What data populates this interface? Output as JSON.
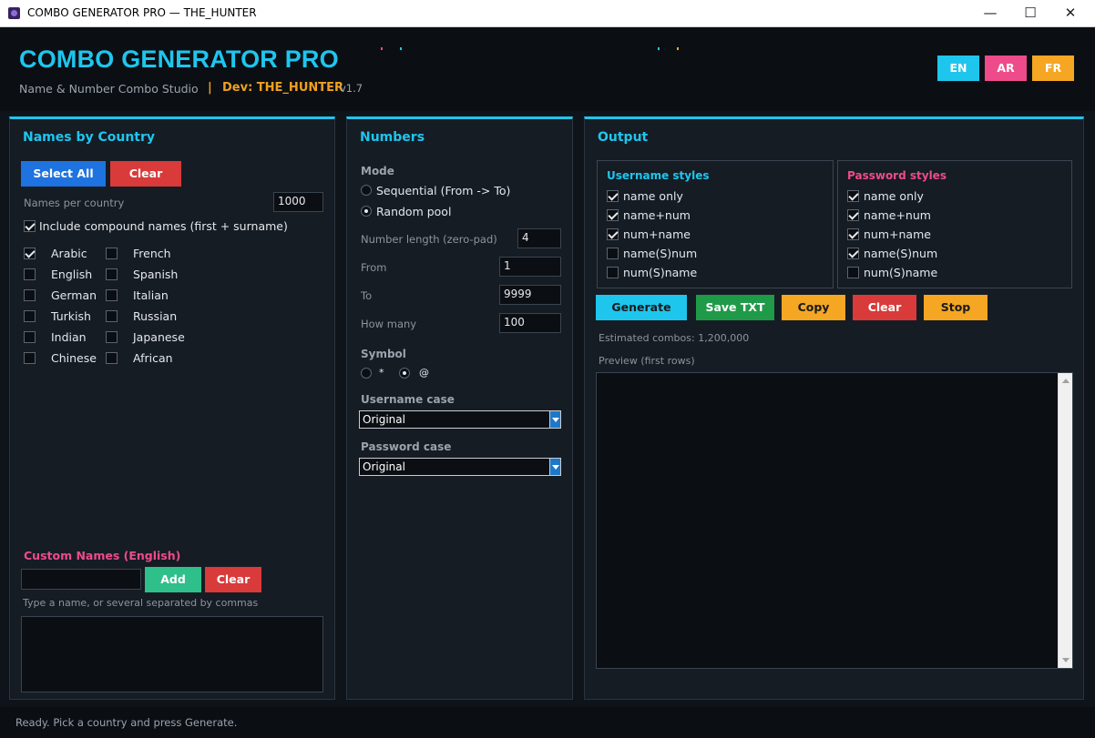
{
  "window": {
    "title": "COMBO GENERATOR PRO — THE_HUNTER",
    "minimize": "—",
    "maximize": "☐",
    "close": "✕"
  },
  "header": {
    "app_name": "COMBO GENERATOR PRO",
    "subtitle": "Name & Number Combo Studio",
    "separator": "|",
    "dev": "Dev: THE_HUNTER",
    "version": "v1.7",
    "languages": [
      "EN",
      "AR",
      "FR"
    ],
    "colors": {
      "accent": "#1ec6ee",
      "dev": "#f0a020",
      "ar": "#ee4b8a",
      "fr": "#f5a623"
    }
  },
  "names_panel": {
    "title": "Names by Country",
    "select_all": "Select All",
    "clear": "Clear",
    "per_country_label": "Names per country",
    "per_country_value": "1000",
    "compound_label": "Include compound names (first + surname)",
    "compound_checked": true,
    "countries": [
      {
        "label": "Arabic",
        "checked": true
      },
      {
        "label": "French",
        "checked": false
      },
      {
        "label": "English",
        "checked": false
      },
      {
        "label": "Spanish",
        "checked": false
      },
      {
        "label": "German",
        "checked": false
      },
      {
        "label": "Italian",
        "checked": false
      },
      {
        "label": "Turkish",
        "checked": false
      },
      {
        "label": "Russian",
        "checked": false
      },
      {
        "label": "Indian",
        "checked": false
      },
      {
        "label": "Japanese",
        "checked": false
      },
      {
        "label": "Chinese",
        "checked": false
      },
      {
        "label": "African",
        "checked": false
      }
    ],
    "custom_title": "Custom Names (English)",
    "custom_input_value": "",
    "add": "Add",
    "custom_clear": "Clear",
    "custom_hint": "Type a name, or several separated by commas"
  },
  "numbers_panel": {
    "title": "Numbers",
    "mode_label": "Mode",
    "mode_options": [
      "Sequential (From -> To)",
      "Random pool"
    ],
    "mode_selected": "Random pool",
    "length_label": "Number length (zero-pad)",
    "length_value": "4",
    "from_label": "From",
    "from_value": "1",
    "to_label": "To",
    "to_value": "9999",
    "how_many_label": "How many",
    "how_many_value": "100",
    "symbol_label": "Symbol",
    "symbol_options": [
      "*",
      "@"
    ],
    "symbol_selected": "@",
    "username_case_label": "Username case",
    "username_case_value": "Original",
    "password_case_label": "Password case",
    "password_case_value": "Original"
  },
  "output_panel": {
    "title": "Output",
    "username_styles_title": "Username styles",
    "username_styles": [
      {
        "label": "name only",
        "checked": true
      },
      {
        "label": "name+num",
        "checked": true
      },
      {
        "label": "num+name",
        "checked": true
      },
      {
        "label": "name(S)num",
        "checked": false
      },
      {
        "label": "num(S)name",
        "checked": false
      }
    ],
    "password_styles_title": "Password styles",
    "password_styles": [
      {
        "label": "name only",
        "checked": true
      },
      {
        "label": "name+num",
        "checked": true
      },
      {
        "label": "num+name",
        "checked": true
      },
      {
        "label": "name(S)num",
        "checked": true
      },
      {
        "label": "num(S)name",
        "checked": false
      }
    ],
    "buttons": [
      "Generate",
      "Save TXT",
      "Copy",
      "Clear",
      "Stop"
    ],
    "button_colors": [
      "#1ec6ee",
      "#1f9a48",
      "#f5a623",
      "#d93a3a",
      "#f5a623"
    ],
    "estimated": "Estimated combos: 1,200,000",
    "preview_label": "Preview (first rows)"
  },
  "status": "Ready. Pick a country and press Generate."
}
